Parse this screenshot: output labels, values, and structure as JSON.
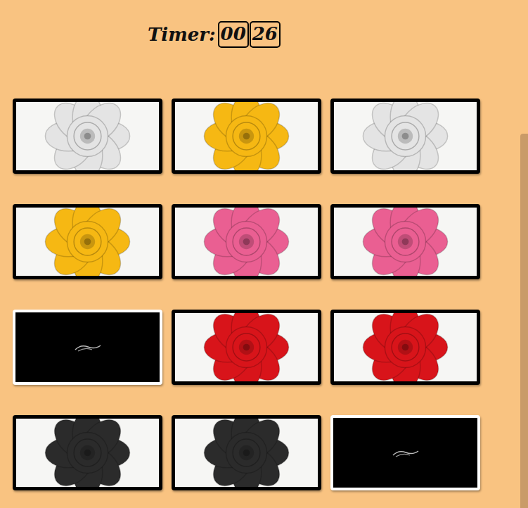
{
  "timer": {
    "label": "Timer:",
    "minutes": "00",
    "seconds": "26"
  },
  "cards": [
    {
      "flipped": true,
      "color": "#e4e4e4"
    },
    {
      "flipped": true,
      "color": "#f6b813"
    },
    {
      "flipped": true,
      "color": "#e4e4e4"
    },
    {
      "flipped": true,
      "color": "#f6b813"
    },
    {
      "flipped": true,
      "color": "#ea5f92"
    },
    {
      "flipped": true,
      "color": "#ea5f92"
    },
    {
      "flipped": false
    },
    {
      "flipped": true,
      "color": "#d8141a"
    },
    {
      "flipped": true,
      "color": "#d8141a"
    },
    {
      "flipped": true,
      "color": "#2b2b2b"
    },
    {
      "flipped": true,
      "color": "#2b2b2b"
    },
    {
      "flipped": false
    }
  ]
}
